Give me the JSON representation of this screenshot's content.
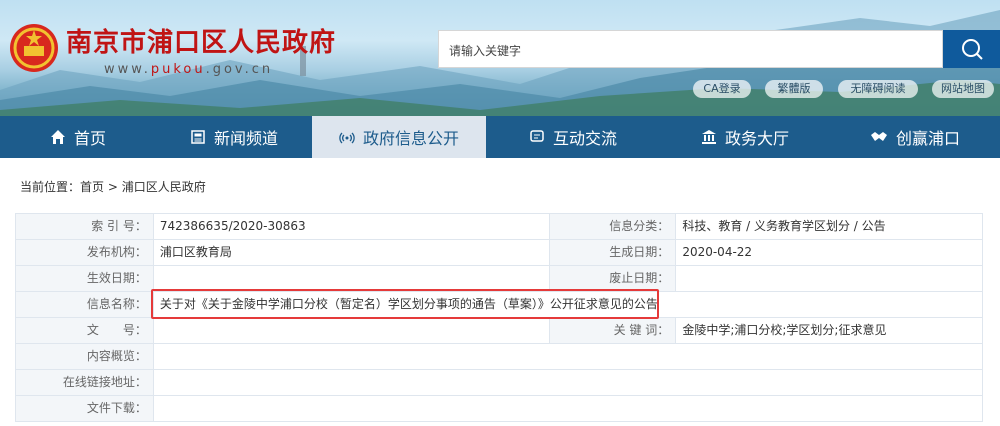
{
  "header": {
    "title": "南京市浦口区人民政府",
    "url_prefix": "www.",
    "url_domain": "pukou",
    "url_suffix": ".gov.cn",
    "search_placeholder": "请输入关键字"
  },
  "tools": [
    "CA登录",
    "繁體版",
    "无障碍阅读",
    "网站地图"
  ],
  "nav": [
    {
      "label": "首页",
      "icon": "home-icon"
    },
    {
      "label": "新闻频道",
      "icon": "newspaper-icon"
    },
    {
      "label": "政府信息公开",
      "icon": "broadcast-icon",
      "active": true
    },
    {
      "label": "互动交流",
      "icon": "chat-icon"
    },
    {
      "label": "政务大厅",
      "icon": "building-icon"
    },
    {
      "label": "创赢浦口",
      "icon": "handshake-icon"
    }
  ],
  "breadcrumb": {
    "prefix": "当前位置：",
    "home": "首页",
    "sep": " > ",
    "current": "浦口区人民政府"
  },
  "info": {
    "index_label": "索 引 号：",
    "index_value": "742386635/2020-30863",
    "category_label": "信息分类：",
    "category_value": "科技、教育 / 义务教育学区划分 / 公告",
    "publisher_label": "发布机构：",
    "publisher_value": "浦口区教育局",
    "created_label": "生成日期：",
    "created_value": "2020-04-22",
    "effective_label": "生效日期：",
    "effective_value": "",
    "expired_label": "废止日期：",
    "expired_value": "",
    "name_label": "信息名称：",
    "name_value": "关于对《关于金陵中学浦口分校（暂定名）学区划分事项的通告（草案）》公开征求意见的公告",
    "docno_label": "文　　号：",
    "docno_value": "",
    "keywords_label": "关 键 词：",
    "keywords_value": "金陵中学;浦口分校;学区划分;征求意见",
    "summary_label": "内容概览：",
    "summary_value": "",
    "link_label": "在线链接地址：",
    "link_value": "",
    "download_label": "文件下载：",
    "download_value": ""
  },
  "colors": {
    "nav_bg": "#1d5c8c",
    "title_red": "#c01414",
    "highlight": "#e53a3a"
  }
}
